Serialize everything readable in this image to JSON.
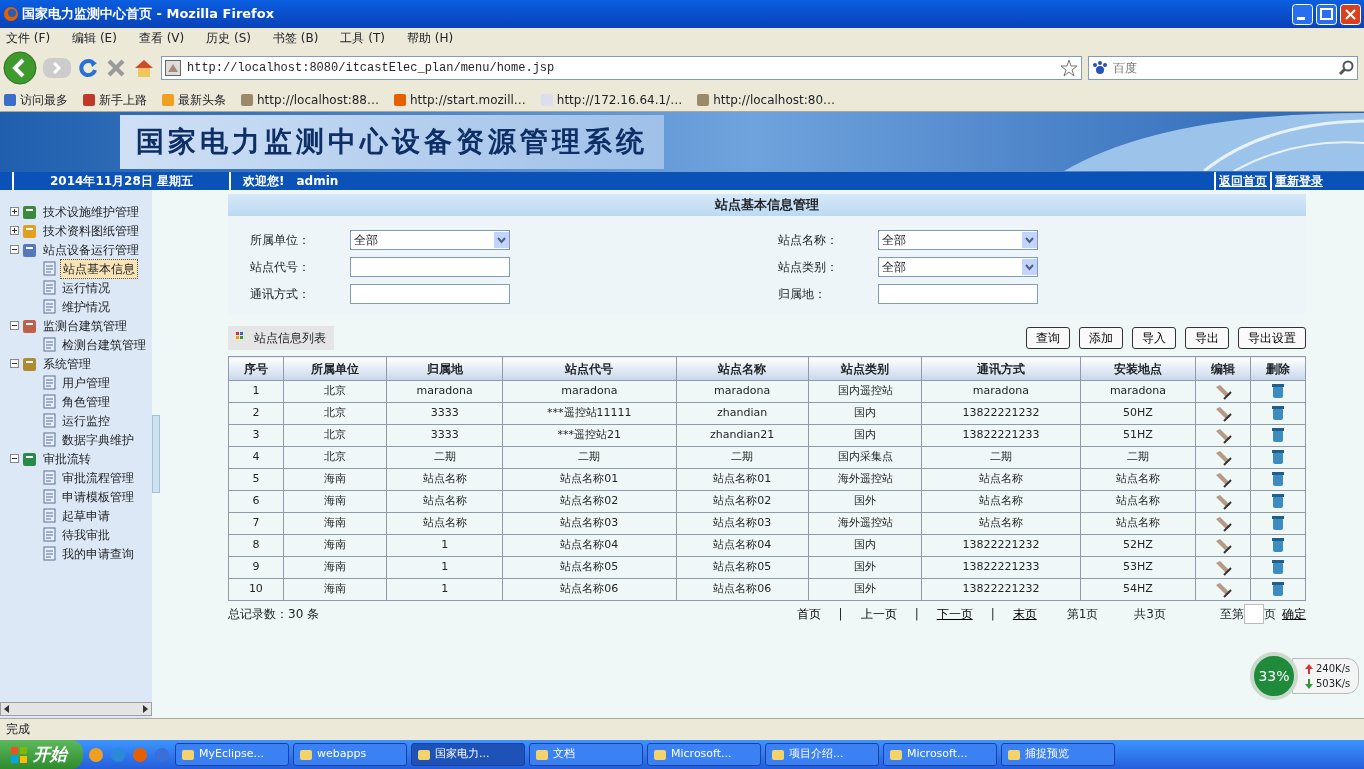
{
  "window": {
    "title": "国家电力监测中心首页 - Mozilla Firefox"
  },
  "menu_bar": [
    "文件 (F)",
    "编辑 (E)",
    "查看 (V)",
    "历史 (S)",
    "书签 (B)",
    "工具 (T)",
    "帮助 (H)"
  ],
  "address_bar": {
    "value": "http://localhost:8080/itcastElec_plan/menu/home.jsp"
  },
  "search": {
    "placeholder": "百度"
  },
  "bookmarks": [
    "访问最多",
    "新手上路",
    "最新头条",
    "http://localhost:88…",
    "http://start.mozill…",
    "http://172.16.64.1/…",
    "http://localhost:80…"
  ],
  "banner": {
    "title": "国家电力监测中心设备资源管理系统"
  },
  "info_bar": {
    "date": "2014年11月28日 星期五",
    "welcome": "欢迎您!",
    "user": "admin",
    "links": [
      "返回首页",
      "重新登录"
    ]
  },
  "sidebar": {
    "items": [
      {
        "label": "技术设施维护管理",
        "expanded": false,
        "selected": false
      },
      {
        "label": "技术资料图纸管理",
        "expanded": false,
        "selected": false
      },
      {
        "label": "站点设备运行管理",
        "expanded": true,
        "selected": false,
        "children": [
          {
            "label": "站点基本信息",
            "selected": true
          },
          {
            "label": "运行情况",
            "selected": false
          },
          {
            "label": "维护情况",
            "selected": false
          }
        ]
      },
      {
        "label": "监测台建筑管理",
        "expanded": true,
        "selected": false,
        "children": [
          {
            "label": "检测台建筑管理",
            "selected": false
          }
        ]
      },
      {
        "label": "系统管理",
        "expanded": true,
        "selected": false,
        "children": [
          {
            "label": "用户管理",
            "selected": false
          },
          {
            "label": "角色管理",
            "selected": false
          },
          {
            "label": "运行监控",
            "selected": false
          },
          {
            "label": "数据字典维护",
            "selected": false
          }
        ]
      },
      {
        "label": "审批流转",
        "expanded": true,
        "selected": false,
        "children": [
          {
            "label": "审批流程管理",
            "selected": false
          },
          {
            "label": "申请模板管理",
            "selected": false
          },
          {
            "label": "起草申请",
            "selected": false
          },
          {
            "label": "待我审批",
            "selected": false
          },
          {
            "label": "我的申请查询",
            "selected": false
          }
        ]
      }
    ]
  },
  "panel_title": "站点基本信息管理",
  "filters": [
    {
      "label": "所属单位：",
      "kind": "select",
      "value": "全部"
    },
    {
      "label": "站点名称：",
      "kind": "select",
      "value": "全部"
    },
    {
      "label": "站点代号：",
      "kind": "text"
    },
    {
      "label": "站点类别：",
      "kind": "select",
      "value": "全部"
    },
    {
      "label": "通讯方式：",
      "kind": "text"
    },
    {
      "label": "归属地：",
      "kind": "text"
    }
  ],
  "list_title": "站点信息列表",
  "buttons": [
    "查询",
    "添加",
    "导入",
    "导出",
    "导出设置"
  ],
  "table": {
    "columns": [
      "序号",
      "所属单位",
      "归属地",
      "站点代号",
      "站点名称",
      "站点类别",
      "通讯方式",
      "安装地点",
      "编辑",
      "删除"
    ],
    "rows": [
      [
        "1",
        "北京",
        "maradona",
        "maradona",
        "maradona",
        "国内遥控站",
        "maradona",
        "maradona"
      ],
      [
        "2",
        "北京",
        "3333",
        "***遥控站11111",
        "zhandian",
        "国内",
        "13822221232",
        "50HZ"
      ],
      [
        "3",
        "北京",
        "3333",
        "***遥控站21",
        "zhandian21",
        "国内",
        "13822221233",
        "51HZ"
      ],
      [
        "4",
        "北京",
        "二期",
        "二期",
        "二期",
        "国内采集点",
        "二期",
        "二期"
      ],
      [
        "5",
        "海南",
        "站点名称",
        "站点名称01",
        "站点名称01",
        "海外遥控站",
        "站点名称",
        "站点名称"
      ],
      [
        "6",
        "海南",
        "站点名称",
        "站点名称02",
        "站点名称02",
        "国外",
        "站点名称",
        "站点名称"
      ],
      [
        "7",
        "海南",
        "站点名称",
        "站点名称03",
        "站点名称03",
        "海外遥控站",
        "站点名称",
        "站点名称"
      ],
      [
        "8",
        "海南",
        "1",
        "站点名称04",
        "站点名称04",
        "国内",
        "13822221232",
        "52HZ"
      ],
      [
        "9",
        "海南",
        "1",
        "站点名称05",
        "站点名称05",
        "国外",
        "13822221233",
        "53HZ"
      ],
      [
        "10",
        "海南",
        "1",
        "站点名称06",
        "站点名称06",
        "国外",
        "13822221232",
        "54HZ"
      ]
    ]
  },
  "total": "总记录数：30 条",
  "pager": [
    {
      "kind": "link",
      "text": "首页",
      "enabled": false
    },
    {
      "kind": "sep",
      "text": "|"
    },
    {
      "kind": "link",
      "text": "上一页",
      "enabled": false
    },
    {
      "kind": "sep",
      "text": "|"
    },
    {
      "kind": "link",
      "text": "下一页",
      "enabled": true
    },
    {
      "kind": "sep",
      "text": "|"
    },
    {
      "kind": "link",
      "text": "末页",
      "enabled": true
    },
    {
      "kind": "text",
      "text": "第1页"
    },
    {
      "kind": "text",
      "text": "共3页"
    }
  ],
  "goto": {
    "before": "至第",
    "after": "页",
    "button": "确定"
  },
  "speed_widget": {
    "percent": "33%",
    "up": "240K/s",
    "down": "503K/s"
  },
  "status_bar": "完成",
  "taskbar": {
    "start": "开始",
    "tasks": [
      {
        "label": "MyEclipse...",
        "selected": false
      },
      {
        "label": "webapps",
        "selected": false
      },
      {
        "label": "国家电力...",
        "selected": true
      },
      {
        "label": "文档",
        "selected": false
      },
      {
        "label": "Microsoft...",
        "selected": false
      },
      {
        "label": "项目介绍...",
        "selected": false
      },
      {
        "label": "Microsoft...",
        "selected": false
      },
      {
        "label": "捕捉预览",
        "selected": false
      }
    ]
  }
}
